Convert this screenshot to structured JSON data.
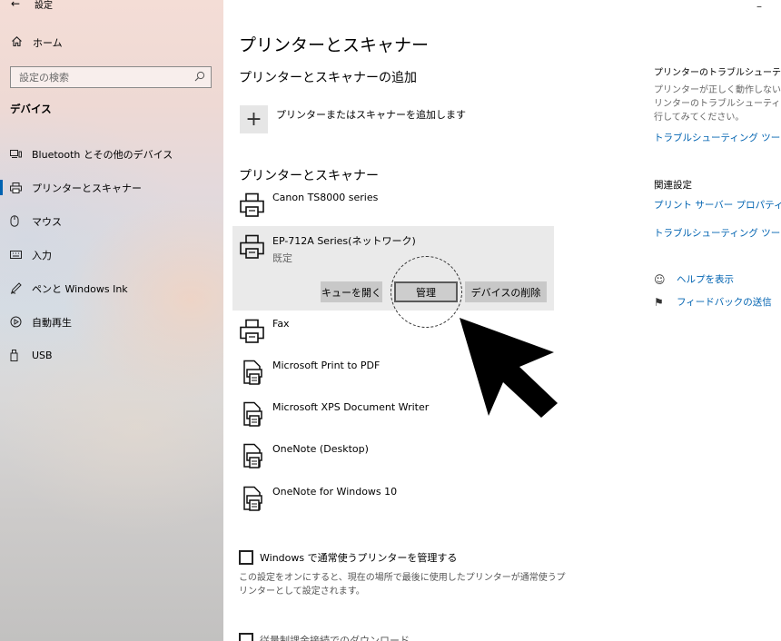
{
  "window": {
    "title": "設定",
    "back_glyph": "←",
    "minimize_glyph": "–"
  },
  "sidebar": {
    "home_label": "ホーム",
    "search_placeholder": "設定の検索",
    "section_title": "デバイス",
    "items": [
      {
        "label": "Bluetooth とその他のデバイス",
        "icon": "bluetooth-devices-icon",
        "glyph": "⌨"
      },
      {
        "label": "プリンターとスキャナー",
        "icon": "printer-icon",
        "glyph": "⎙",
        "active": true
      },
      {
        "label": "マウス",
        "icon": "mouse-icon",
        "glyph": "▯"
      },
      {
        "label": "入力",
        "icon": "keyboard-icon",
        "glyph": "⌨"
      },
      {
        "label": "ペンと Windows Ink",
        "icon": "pen-icon",
        "glyph": "✒"
      },
      {
        "label": "自動再生",
        "icon": "autoplay-icon",
        "glyph": "◉"
      },
      {
        "label": "USB",
        "icon": "usb-icon",
        "glyph": "▯"
      }
    ]
  },
  "main": {
    "title": "プリンターとスキャナー",
    "add_heading": "プリンターとスキャナーの追加",
    "add_button_glyph": "+",
    "add_label": "プリンターまたはスキャナーを追加します",
    "printers_heading": "プリンターとスキャナー",
    "printers": [
      {
        "name": "Canon TS8000 series",
        "icon": "printer-icon"
      },
      {
        "name": "EP-712A Series(ネットワーク)",
        "status": "既定",
        "icon": "printer-icon",
        "selected": true
      },
      {
        "name": "Fax",
        "icon": "printer-icon"
      },
      {
        "name": "Microsoft Print to PDF",
        "icon": "document-printer-icon"
      },
      {
        "name": "Microsoft XPS Document Writer",
        "icon": "document-printer-icon"
      },
      {
        "name": "OneNote (Desktop)",
        "icon": "document-printer-icon"
      },
      {
        "name": "OneNote for Windows 10",
        "icon": "document-printer-icon"
      }
    ],
    "actions": {
      "open_queue": "キューを開く",
      "manage": "管理",
      "remove_device": "デバイスの削除"
    },
    "default_checkbox_label": "Windows で通常使うプリンターを管理する",
    "default_checkbox_checked": false,
    "default_note": "この設定をオンにすると、現在の場所で最後に使用したプリンターが通常使うプリンターとして設定されます。",
    "cutoff_checkbox_label": "従量制課金接続でのダウンロード"
  },
  "right_panel": {
    "troubleshoot_heading": "プリンターのトラブルシューティング",
    "troubleshoot_desc_lines": [
      "プリンターが正しく動作しない場",
      "リンターのトラブルシューティング",
      "行してみてください。"
    ],
    "troubleshoot_link": "トラブルシューティング ツールの設",
    "related_heading": "関連設定",
    "print_server_link": "プリント サーバー プロパティ",
    "troubleshoot_run_link": "トラブルシューティング ツールの実",
    "help_link": "ヘルプを表示",
    "help_glyph": "☺",
    "feedback_link": "フィードバックの送信",
    "feedback_glyph": "⚑"
  },
  "colors": {
    "accent": "#0063b1",
    "selected_bg": "#eaeaea",
    "button_bg": "#c8c8c8"
  }
}
